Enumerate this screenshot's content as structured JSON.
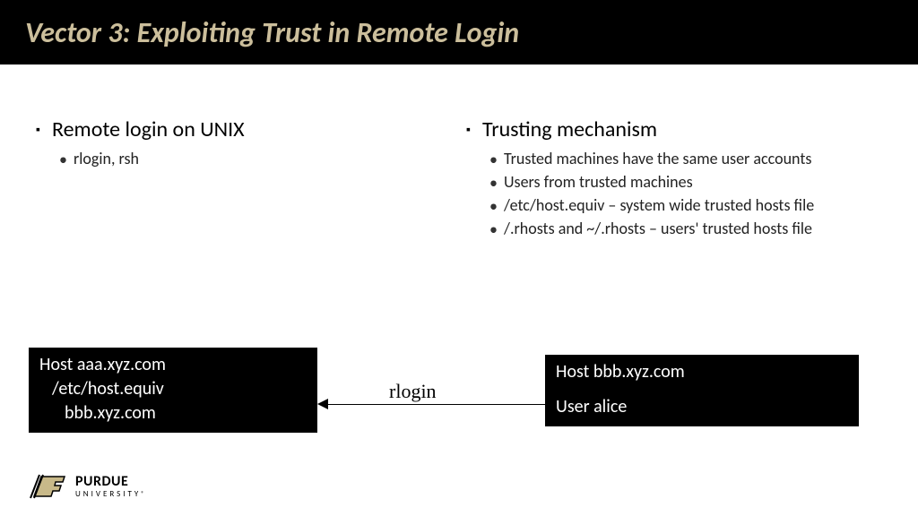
{
  "title": "Vector 3: Exploiting Trust in Remote Login",
  "left": {
    "heading": "Remote login on UNIX",
    "items": [
      "rlogin, rsh"
    ]
  },
  "right": {
    "heading": "Trusting mechanism",
    "items": [
      "Trusted machines have the same user accounts",
      "Users from trusted machines",
      "/etc/host.equiv – system wide trusted hosts file",
      "/.rhosts and ~/.rhosts – users' trusted hosts file"
    ]
  },
  "hostA": {
    "line1": "Host aaa.xyz.com",
    "line2": "/etc/host.equiv",
    "line3": "bbb.xyz.com"
  },
  "hostB": {
    "line1": "Host bbb.xyz.com",
    "line2": "User alice"
  },
  "arrow_label": "rlogin",
  "logo": {
    "main": "PURDUE",
    "sub": "UNIVERSITY",
    "reg": "®"
  }
}
